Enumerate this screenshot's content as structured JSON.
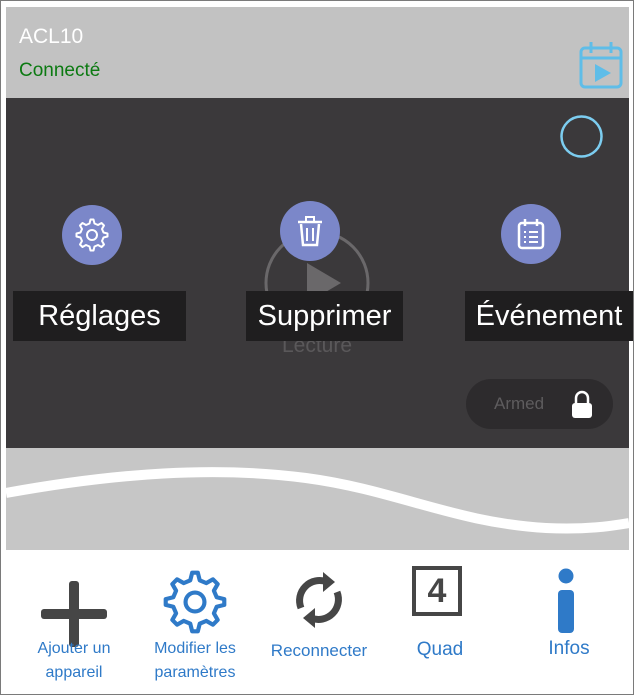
{
  "header": {
    "device_name": "ACL10",
    "status": "Connecté",
    "status_color": "#0c7a12",
    "calendar_icon": "calendar-play-icon",
    "accent": "#5fbde8"
  },
  "video": {
    "play_label": "Lecture",
    "actions": [
      {
        "icon": "gear-icon",
        "label": "Réglages"
      },
      {
        "icon": "trash-icon",
        "label": "Supprimer"
      },
      {
        "icon": "calendar-list-icon",
        "label": "Événement"
      }
    ],
    "armed": {
      "label": "Armed",
      "icon": "lock-icon"
    },
    "spinner_icon": "loading-circle-icon"
  },
  "toolbar": {
    "items": [
      {
        "icon": "plus-icon",
        "label_line1": "Ajouter un",
        "label_line2": "appareil"
      },
      {
        "icon": "gear-icon",
        "label_line1": "Modifier les",
        "label_line2": "paramètres"
      },
      {
        "icon": "refresh-icon",
        "label_line1": "Reconnecter",
        "label_line2": ""
      },
      {
        "icon": "quad-4-icon",
        "label_line1": "Quad",
        "label_line2": "",
        "glyph": "4"
      },
      {
        "icon": "info-icon",
        "label_line1": "Infos",
        "label_line2": ""
      }
    ]
  }
}
